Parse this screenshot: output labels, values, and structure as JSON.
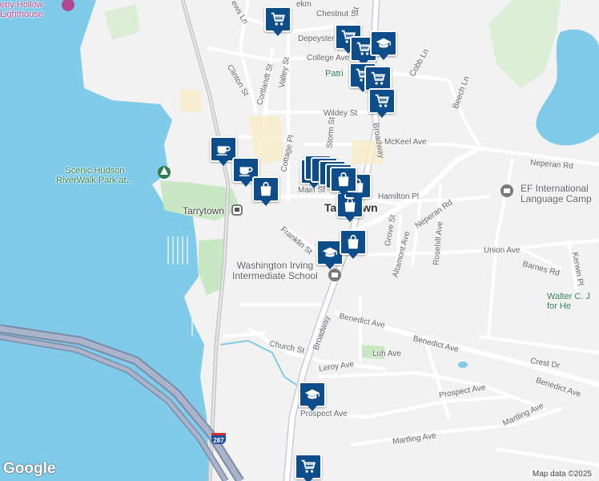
{
  "map": {
    "colors": {
      "water": "#80cbe9",
      "park": "#c8e8c4",
      "land": "#f2f2f2",
      "road": "#ffffff",
      "major_road": "#9aa4b8",
      "pin": "#0d4e8a"
    },
    "street_labels": {
      "chestnut": "Chestnut St",
      "depeyster": "Depeyster St",
      "college": "College Ave",
      "cobb": "Cobb Ln",
      "clinton": "Clinton St",
      "cortlandt": "Cortlandt St",
      "valley": "Valley St",
      "wildey": "Wildey St",
      "beech": "Beech Ln",
      "broadway": "Broadway",
      "mckeel": "McKeel Ave",
      "neperan_rd_top": "Neperan Rd",
      "cottage": "Cottage Pl",
      "main": "Main St",
      "hamilton": "Hamilton Pl",
      "neperan_rd": "Neperan Rd",
      "grove": "Grove St",
      "altamont": "Altamont Ave",
      "rosehill": "Rosehill Ave",
      "union": "Union Ave",
      "barnes": "Barnes Rd",
      "kerwin": "Kerwin Pl",
      "franklin": "Franklin St",
      "benedict_1": "Benedict Ave",
      "benedict_2": "Benedict Ave",
      "benedict_3": "Benedict Ave",
      "church": "Church St",
      "leroy": "Leroy Ave",
      "loh": "Loh Ave",
      "crest": "Crest Dr",
      "prospect_1": "Prospect Ave",
      "prospect_2": "Prospect Ave",
      "mertling_1": "Martling Ave",
      "mertling_2": "Martling Ave",
      "broadway_s": "Broadway",
      "storm": "Storm St",
      "mews": "ews Ln",
      "ekm": "ekm",
      "st": "St"
    },
    "place_labels": {
      "lighthouse": "epy Hollow\nLighthouse",
      "riverwalk": "Scenic Hudson\nRiverWalk Park at...",
      "tarrytown_station": "Tarrytown",
      "school": "Washington Irving\nIntermediate School",
      "ef": "EF International\nLanguage Camp",
      "walter": "Walter C. J\nfor He",
      "patri": "Patri",
      "town": "Tarrytown"
    },
    "highway_shield": "287",
    "google": "Google",
    "attribution": "Map data ©2025",
    "pins": [
      {
        "icon": "cart"
      },
      {
        "icon": "cart"
      },
      {
        "icon": "cart"
      },
      {
        "icon": "cart"
      },
      {
        "icon": "cart"
      },
      {
        "icon": "cart"
      },
      {
        "icon": "cart"
      },
      {
        "icon": "graduation-cap"
      },
      {
        "icon": "graduation-cap"
      },
      {
        "icon": "graduation-cap"
      },
      {
        "icon": "coffee-cup"
      },
      {
        "icon": "coffee-cup"
      },
      {
        "icon": "shopping-bag"
      },
      {
        "icon": "shopping-bag"
      },
      {
        "icon": "shopping-bag"
      },
      {
        "icon": "shopping-bag"
      },
      {
        "icon": "shopping-bag"
      }
    ]
  }
}
